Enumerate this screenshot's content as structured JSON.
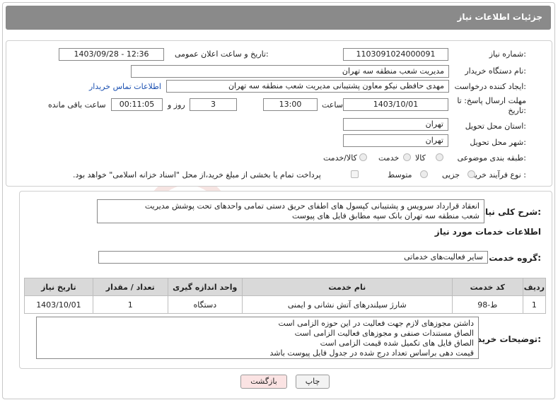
{
  "header": {
    "title": "جزئیات اطلاعات نیاز"
  },
  "form": {
    "need_number": {
      "label": "شماره نیاز:",
      "value": "1103091024000091"
    },
    "announce_datetime": {
      "label": "تاریخ و ساعت اعلان عمومی:",
      "value": "1403/09/28 - 12:36"
    },
    "buyer_org": {
      "label": "نام دستگاه خریدار:",
      "value": "مدیریت شعب منطقه سه تهران"
    },
    "requester": {
      "label": "ایجاد کننده درخواست:",
      "value": "مهدی حافظی نیکو معاون پشتیبانی مدیریت شعب منطقه سه تهران"
    },
    "buyer_contact_link": "اطلاعات تماس خریدار",
    "deadline": {
      "label_line1": "مهلت ارسال پاسخ: تا",
      "label_line2": "تاریخ:",
      "date": "1403/10/01",
      "time_label": "ساعت",
      "time": "13:00",
      "days": "3",
      "days_label": "روز و",
      "remaining": "00:11:05",
      "remaining_label": "ساعت باقی مانده"
    },
    "delivery_province": {
      "label": "استان محل تحویل:",
      "value": "تهران"
    },
    "delivery_city": {
      "label": "شهر محل تحویل:",
      "value": "تهران"
    },
    "category": {
      "label": "طبقه بندی موضوعی:",
      "options": [
        "کالا",
        "خدمت",
        "کالا/خدمت"
      ]
    },
    "purchase_type": {
      "label": "نوع فرآیند خرید :",
      "options": [
        "جزیی",
        "متوسط"
      ],
      "payment_note": "پرداخت تمام یا بخشی از مبلغ خرید،از محل \"اسناد خزانه اسلامی\" خواهد بود."
    }
  },
  "summary": {
    "label": "شرح کلی نیاز:",
    "lines": [
      "انعقاد قرارداد سرویس و پشتیبانی کپسول های اطفای حریق دستی تمامی واحدهای تحت پوشش مدیریت",
      "شعب منطقه سه تهران بانک سپه  مطابق فایل های پیوست"
    ]
  },
  "services": {
    "section_title": "اطلاعات خدمات مورد نیاز",
    "group_label": "گروه خدمت:",
    "group_value": "سایر فعالیت‌های خدماتی",
    "table": {
      "headers": [
        "ردیف",
        "کد خدمت",
        "نام خدمت",
        "واحد اندازه گیری",
        "تعداد / مقدار",
        "تاریخ نیاز"
      ],
      "rows": [
        [
          "1",
          "ط-98",
          "شارژ سیلندرهای آتش نشانی و ایمنی",
          "دستگاه",
          "1",
          "1403/10/01"
        ]
      ]
    }
  },
  "buyer_notes": {
    "label": "توضیحات خریدار:",
    "lines": [
      "داشتن مجوزهای لازم جهت فعالیت در این حوزه الزامی است",
      "الصاق مستندات صنفی و مجوزهای فعالیت الزامی است",
      "الصاق فایل های تکمیل شده قیمت الزامی است",
      "قیمت دهی براساس تعداد درج شده در جدول فایل پیوست باشد"
    ]
  },
  "buttons": {
    "print": "چاپ",
    "back": "بازگشت"
  },
  "watermark": "AriaTender.neT",
  "colors": {
    "header_bg": "#8a8a8a",
    "link": "#1a4fb0",
    "back_button_bg": "#fbe3e3",
    "table_header_bg": "#d9d9d9"
  }
}
